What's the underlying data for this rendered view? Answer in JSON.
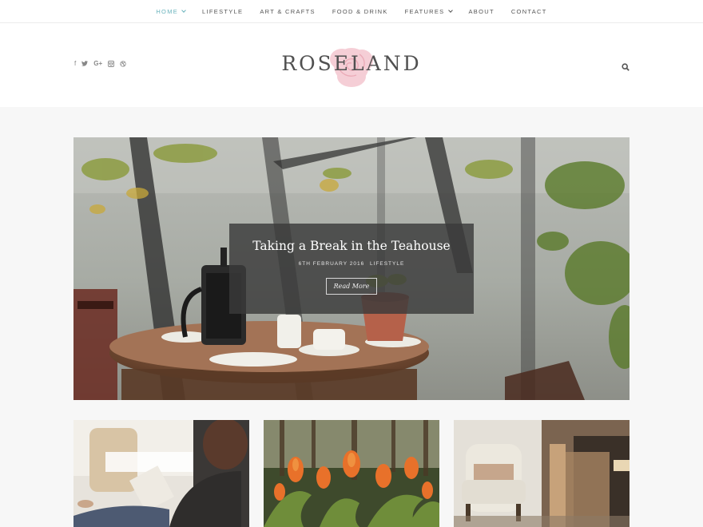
{
  "nav": {
    "items": [
      {
        "label": "Home",
        "dropdown": true,
        "active": true
      },
      {
        "label": "Lifestyle",
        "dropdown": false,
        "active": false
      },
      {
        "label": "Art & Crafts",
        "dropdown": false,
        "active": false
      },
      {
        "label": "Food & Drink",
        "dropdown": false,
        "active": false
      },
      {
        "label": "Features",
        "dropdown": true,
        "active": false
      },
      {
        "label": "About",
        "dropdown": false,
        "active": false
      },
      {
        "label": "Contact",
        "dropdown": false,
        "active": false
      }
    ]
  },
  "header": {
    "site_title": "ROSELAND",
    "social_icons": [
      "facebook-icon",
      "twitter-icon",
      "google-plus-icon",
      "instagram-icon",
      "dribbble-icon"
    ],
    "social_glyphs": {
      "facebook": "f",
      "twitter": "❧",
      "googleplus": "G+",
      "instagram": "▣",
      "dribbble": "◎"
    }
  },
  "featured": {
    "title": "Taking a Break in the Teahouse",
    "date": "6th February 2016",
    "category": "Lifestyle",
    "read_more": "Read More"
  },
  "colors": {
    "accent": "#6bb4bd",
    "logo_rose": "#f4c6cf",
    "caption_bg": "#3a3a3a"
  }
}
